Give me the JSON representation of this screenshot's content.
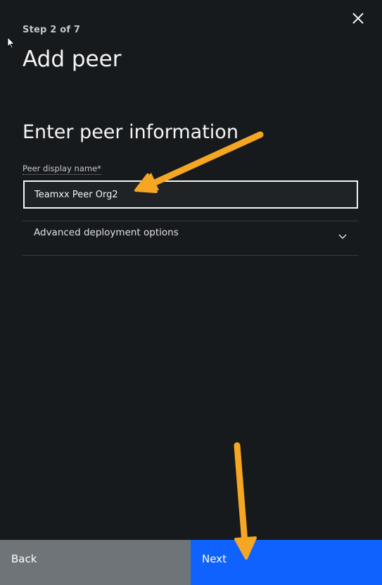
{
  "header": {
    "step": "Step 2 of 7",
    "title": "Add peer"
  },
  "section": {
    "title": "Enter peer information"
  },
  "form": {
    "display_name_label": "Peer display name*",
    "display_name_value": "Teamxx Peer Org2"
  },
  "accordion": {
    "label": "Advanced deployment options",
    "expanded": false
  },
  "footer": {
    "back_label": "Back",
    "next_label": "Next"
  },
  "colors": {
    "background": "#171a1d",
    "back_button": "#6f7478",
    "next_button": "#0f62fe",
    "annotation_arrow": "#f5a623"
  },
  "icons": {
    "close": "close-icon",
    "chevron": "chevron-down-icon",
    "cursor": "mouse-cursor-icon"
  }
}
